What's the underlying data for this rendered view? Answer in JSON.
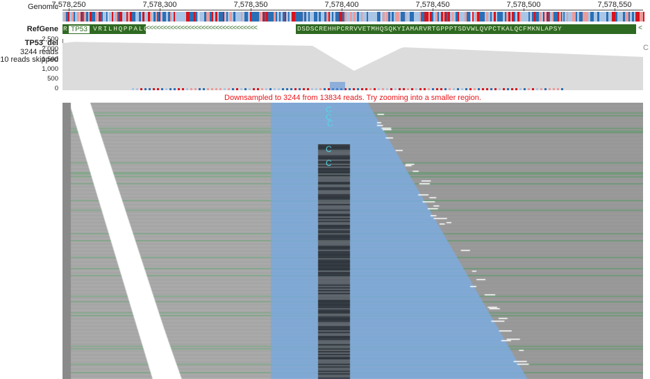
{
  "ruler": {
    "label": "Genomic",
    "ticks": [
      "7,578,250",
      "7,578,300",
      "7,578,350",
      "7,578,400",
      "7,578,450",
      "7,578,500",
      "7,578,550"
    ]
  },
  "refgene": {
    "label": "RefGene",
    "gene_name": "TP53",
    "left_aa": "R",
    "left_exon_seq": "VRILHQPPALC",
    "intron_arrows": "<<<<<<<<<<<<<<<<<<<<<<<<<<<<<<<<",
    "right_exon_seq": "DSDSCREHHPCRRVVETMHQSQKYIAMARVRTGPPPTSDVWLQVPCTKALQCFMKNLAPSY",
    "right_end": "<"
  },
  "bam_track": {
    "name": "TP53_del",
    "read_count": "3244 reads",
    "skipped": "10 reads skipped",
    "coverage_ticks": [
      "2,500",
      "2,000",
      "1,500",
      "1,000",
      "500",
      "0"
    ],
    "downsample_message": "Downsampled to 3244 from 13834 reads. Try zooming into a smaller region.",
    "mismatch_base": "C",
    "mismatch_labels": [
      "C",
      "C",
      "C",
      "C",
      "C"
    ],
    "corner_glyph": "C"
  },
  "colors": {
    "gene": "#2f6a22",
    "read_gray": "#8a8a8a",
    "read_blue": "#6a9fd8",
    "read_green": "#5e8a68",
    "coverage": "#dcdcdc",
    "warning": "#e8161b"
  }
}
